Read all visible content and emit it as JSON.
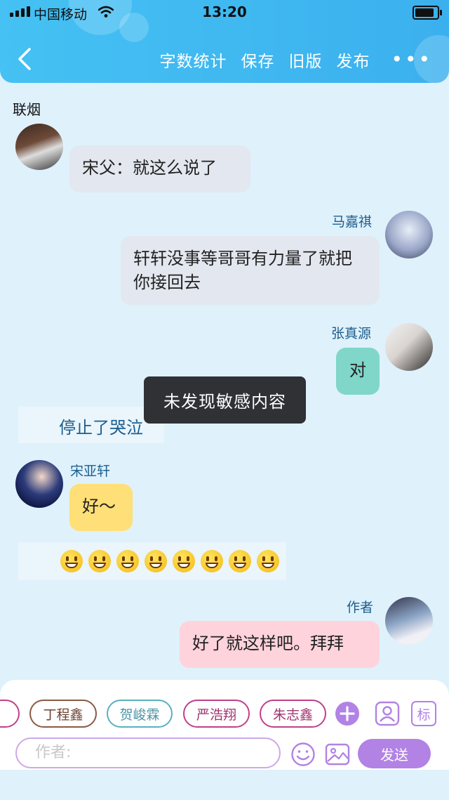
{
  "status": {
    "carrier": "中国移动",
    "time": "13:20"
  },
  "nav": {
    "actions": [
      "字数统计",
      "保存",
      "旧版",
      "发布"
    ],
    "more": "•••"
  },
  "chat_title": "联烟",
  "messages": [
    {
      "text": "宋父：就这么说了",
      "side": "left",
      "style": "gray"
    },
    {
      "name": "马嘉祺",
      "text": "轩轩没事等哥哥有力量了就把你接回去",
      "side": "right",
      "style": "gray"
    },
    {
      "name": "张真源",
      "text": "对",
      "side": "right",
      "style": "teal"
    },
    {
      "narration": "停止了哭泣"
    },
    {
      "name": "宋亚轩",
      "text": "好～",
      "side": "left",
      "style": "yellow"
    },
    {
      "emoji_count": 8
    },
    {
      "name": "作者",
      "text": "好了就这样吧。拜拜",
      "side": "right",
      "style": "pink"
    }
  ],
  "toast": "未发现敏感内容",
  "composer": {
    "chips": [
      {
        "label": "丁程鑫",
        "color": "#8a5a44"
      },
      {
        "label": "贺峻霖",
        "color": "#5ab0c0"
      },
      {
        "label": "严浩翔",
        "color": "#c0408a"
      },
      {
        "label": "朱志鑫",
        "color": "#c0408a"
      }
    ],
    "tag_label": "标",
    "input_placeholder": "作者:",
    "send_label": "发送"
  },
  "colors": {
    "accent": "#b282e4",
    "header": "#45c1f3"
  }
}
